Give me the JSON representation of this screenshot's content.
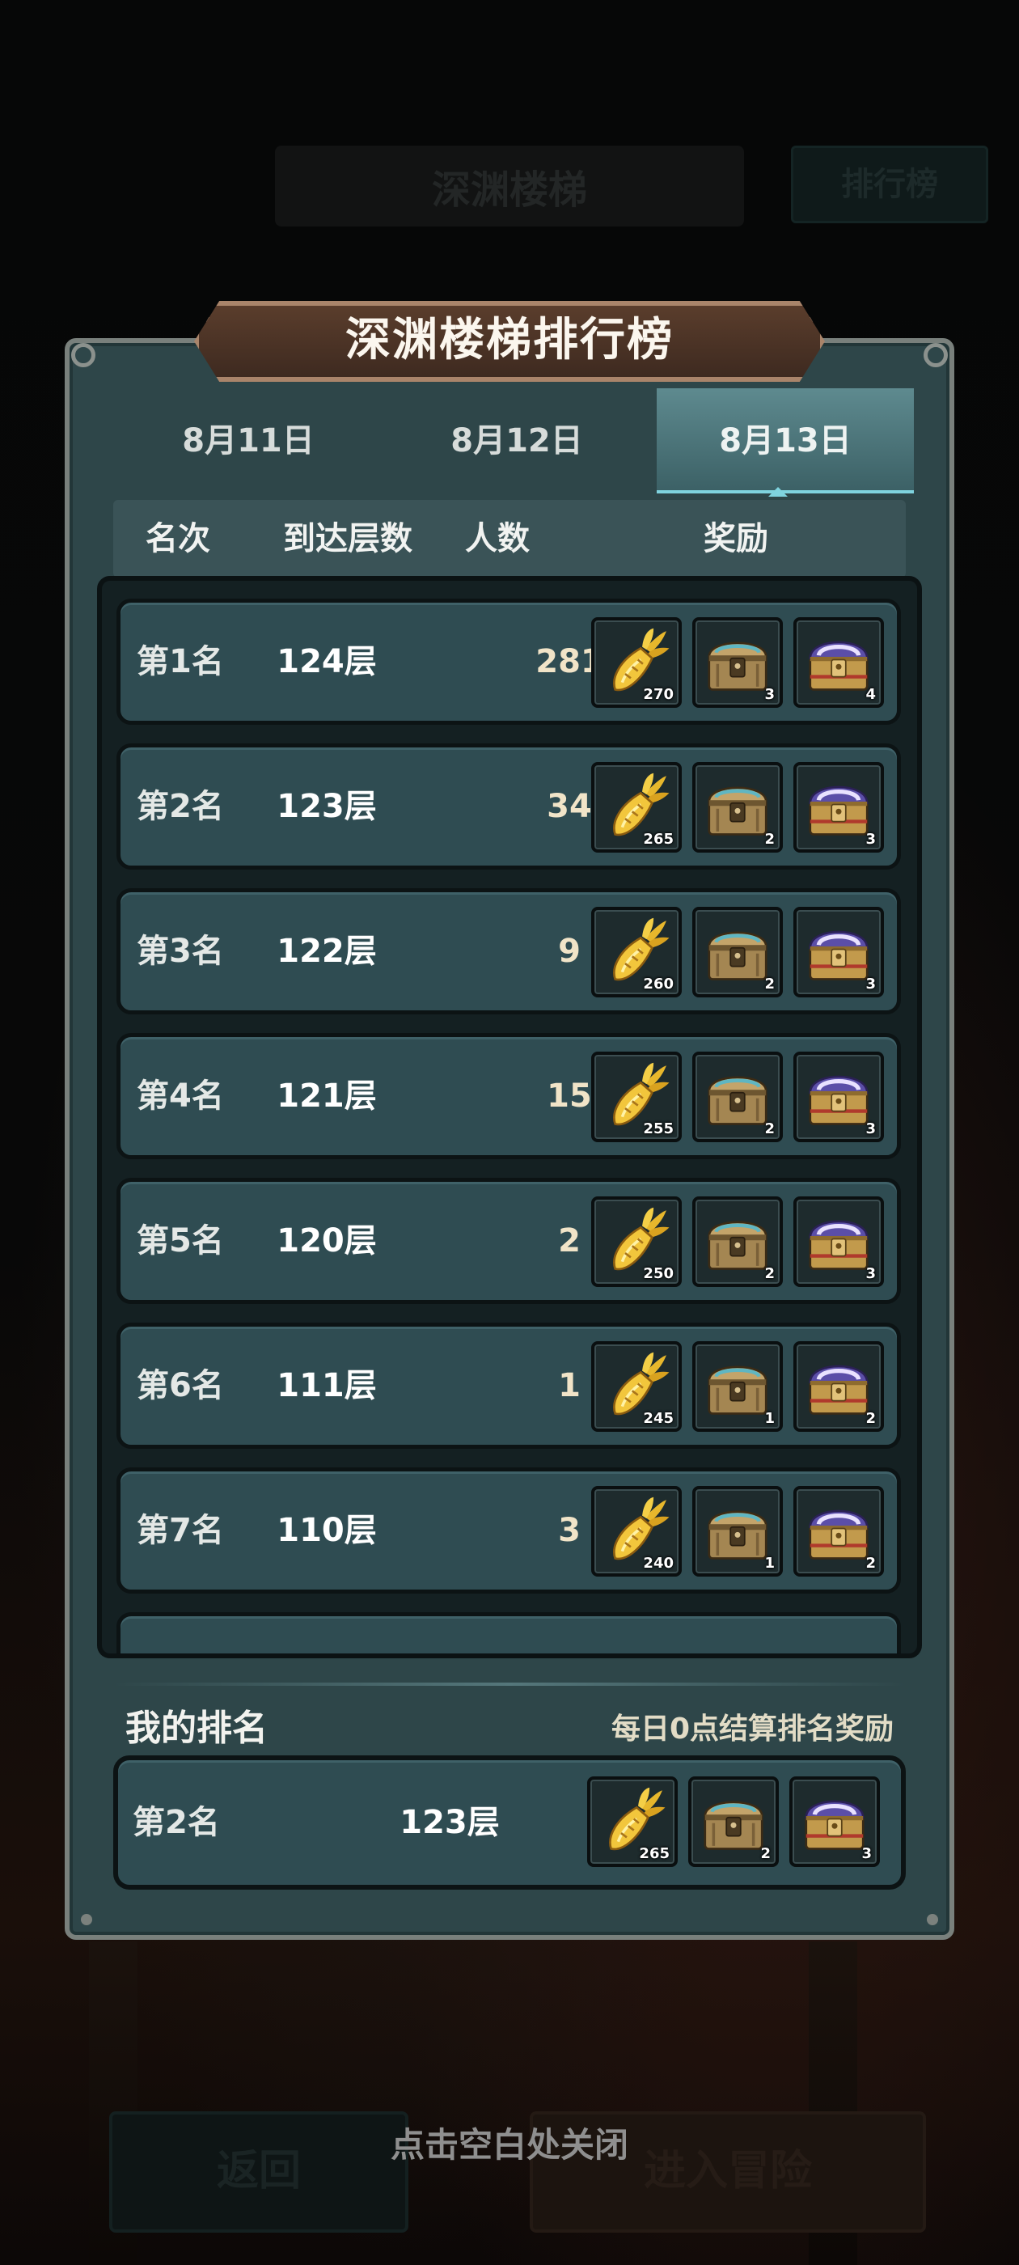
{
  "background": {
    "title": "深渊楼梯",
    "leaderboard_button": "排行榜",
    "back_button": "返回",
    "adventure_button": "进入冒险",
    "close_hint": "点击空白处关闭"
  },
  "panel": {
    "title": "深渊楼梯排行榜",
    "tabs": [
      {
        "label": "8月11日",
        "active": false
      },
      {
        "label": "8月12日",
        "active": false
      },
      {
        "label": "8月13日",
        "active": true
      }
    ],
    "headers": {
      "rank": "名次",
      "floor": "到达层数",
      "count": "人数",
      "reward": "奖励"
    },
    "rows": [
      {
        "rank": "第1名",
        "floor": "124层",
        "count": "281",
        "rewards": [
          "270",
          "3",
          "4"
        ]
      },
      {
        "rank": "第2名",
        "floor": "123层",
        "count": "34",
        "rewards": [
          "265",
          "2",
          "3"
        ]
      },
      {
        "rank": "第3名",
        "floor": "122层",
        "count": "9",
        "rewards": [
          "260",
          "2",
          "3"
        ]
      },
      {
        "rank": "第4名",
        "floor": "121层",
        "count": "15",
        "rewards": [
          "255",
          "2",
          "3"
        ]
      },
      {
        "rank": "第5名",
        "floor": "120层",
        "count": "2",
        "rewards": [
          "250",
          "2",
          "3"
        ]
      },
      {
        "rank": "第6名",
        "floor": "111层",
        "count": "1",
        "rewards": [
          "245",
          "1",
          "2"
        ]
      },
      {
        "rank": "第7名",
        "floor": "110层",
        "count": "3",
        "rewards": [
          "240",
          "1",
          "2"
        ]
      }
    ],
    "reward_icons": [
      "golden-carrot-icon",
      "bronze-chest-icon",
      "purple-chest-icon"
    ],
    "my_rank": {
      "title": "我的排名",
      "note": "每日0点结算排名奖励",
      "rank": "第2名",
      "floor": "123层",
      "rewards": [
        "265",
        "2",
        "3"
      ]
    }
  },
  "colors": {
    "panel": "#2e4649",
    "row": "#2f4c52",
    "active_tab": "#5e8a8f",
    "banner": "#5a3d2c"
  }
}
